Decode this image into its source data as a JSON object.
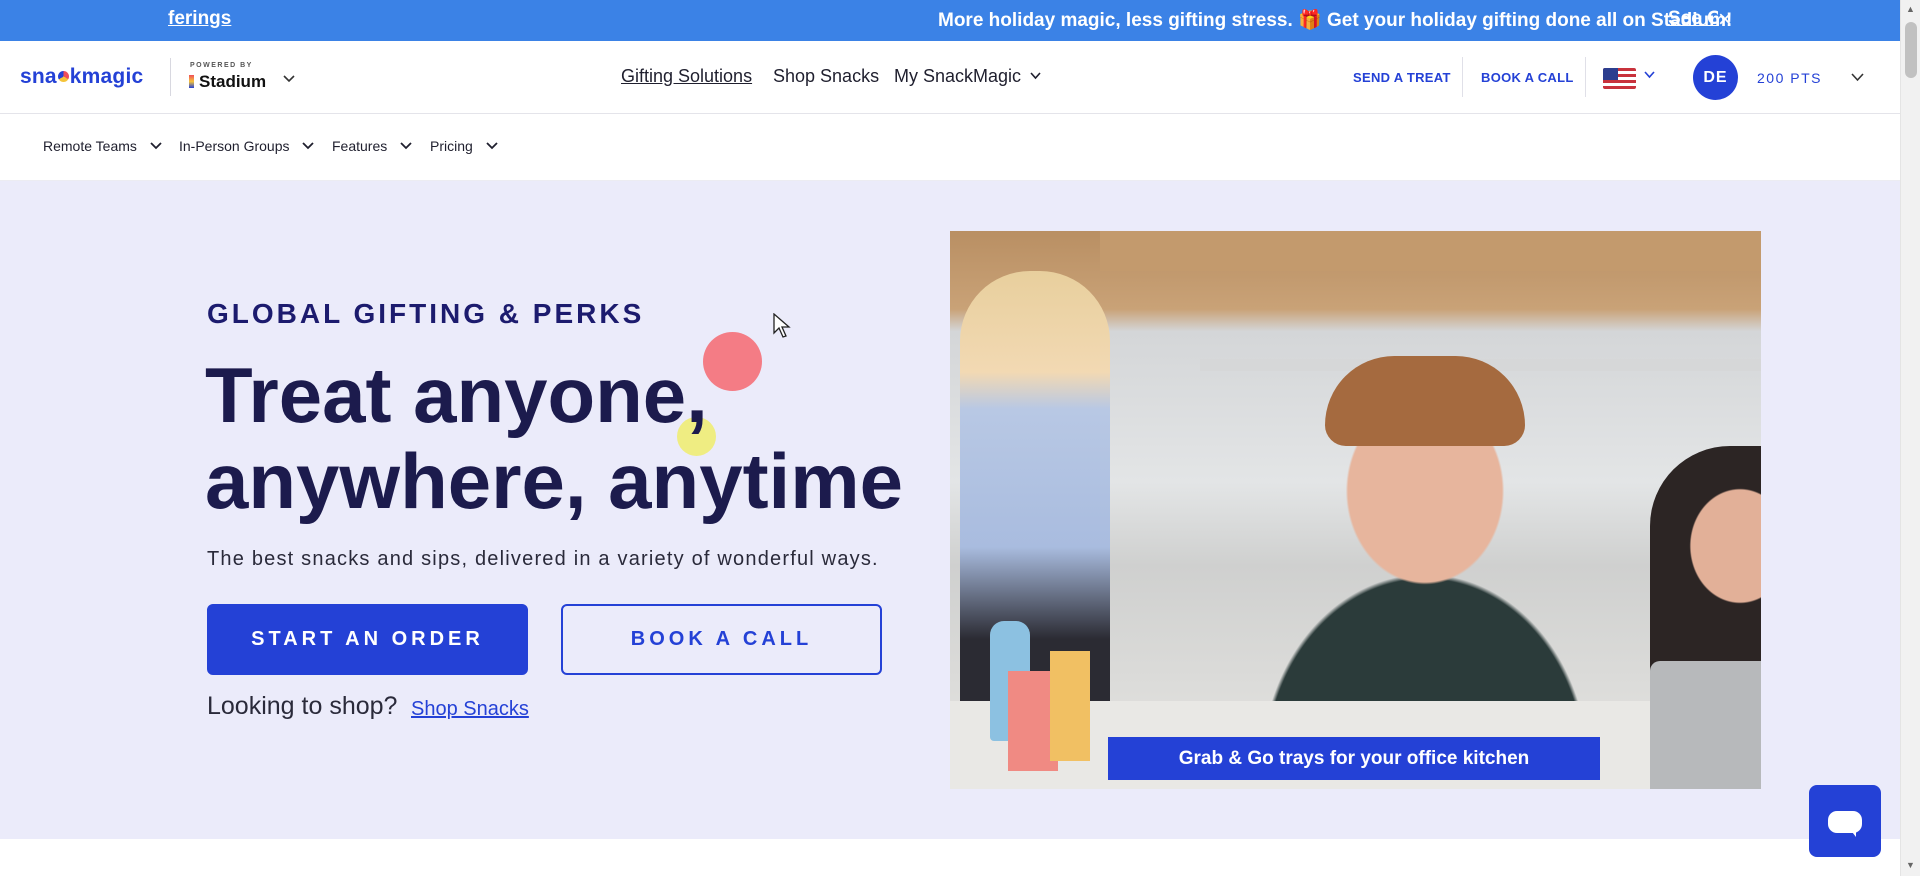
{
  "announcement": {
    "fragment_link": "ferings",
    "message": "More holiday magic, less gifting stress. 🎁 Get your holiday gifting done all on Stadium!",
    "see_link": "See O",
    "close_glyph": "×"
  },
  "header": {
    "logo_prefix": "sna",
    "logo_suffix": "kmagic",
    "powered_by": "POWERED BY",
    "stadium": "Stadium",
    "brand_chevron": "⌄",
    "nav": {
      "gifting": "Gifting Solutions",
      "shop": "Shop Snacks",
      "my_snackmagic": "My SnackMagic"
    },
    "send_treat": "SEND A TREAT",
    "book_call": "BOOK A CALL",
    "avatar_initials": "DE",
    "points": "200 PTS"
  },
  "subnav": {
    "items": [
      {
        "label": "Remote Teams"
      },
      {
        "label": "In-Person Groups"
      },
      {
        "label": "Features"
      },
      {
        "label": "Pricing"
      }
    ]
  },
  "hero": {
    "eyebrow": "GLOBAL GIFTING & PERKS",
    "headline_line1": "Treat anyone,",
    "headline_line2": "anywhere, anytime",
    "subtext": "The best snacks and sips, delivered in a variety of wonderful ways.",
    "primary_button": "START AN ORDER",
    "secondary_button": "BOOK A CALL",
    "shop_question": "Looking to shop?",
    "shop_link": "Shop Snacks",
    "photo_caption": "Grab & Go trays for your office kitchen"
  },
  "colors": {
    "brand_blue": "#2441d6",
    "announcement_blue": "#3b82e6",
    "hero_bg": "#ebebfa",
    "accent_red": "#f47c85",
    "accent_yellow": "#efed82"
  },
  "icons": {
    "chevron": "chevron-down-icon",
    "close": "close-icon",
    "flag": "us-flag-icon",
    "chat": "chat-bubble-icon"
  }
}
